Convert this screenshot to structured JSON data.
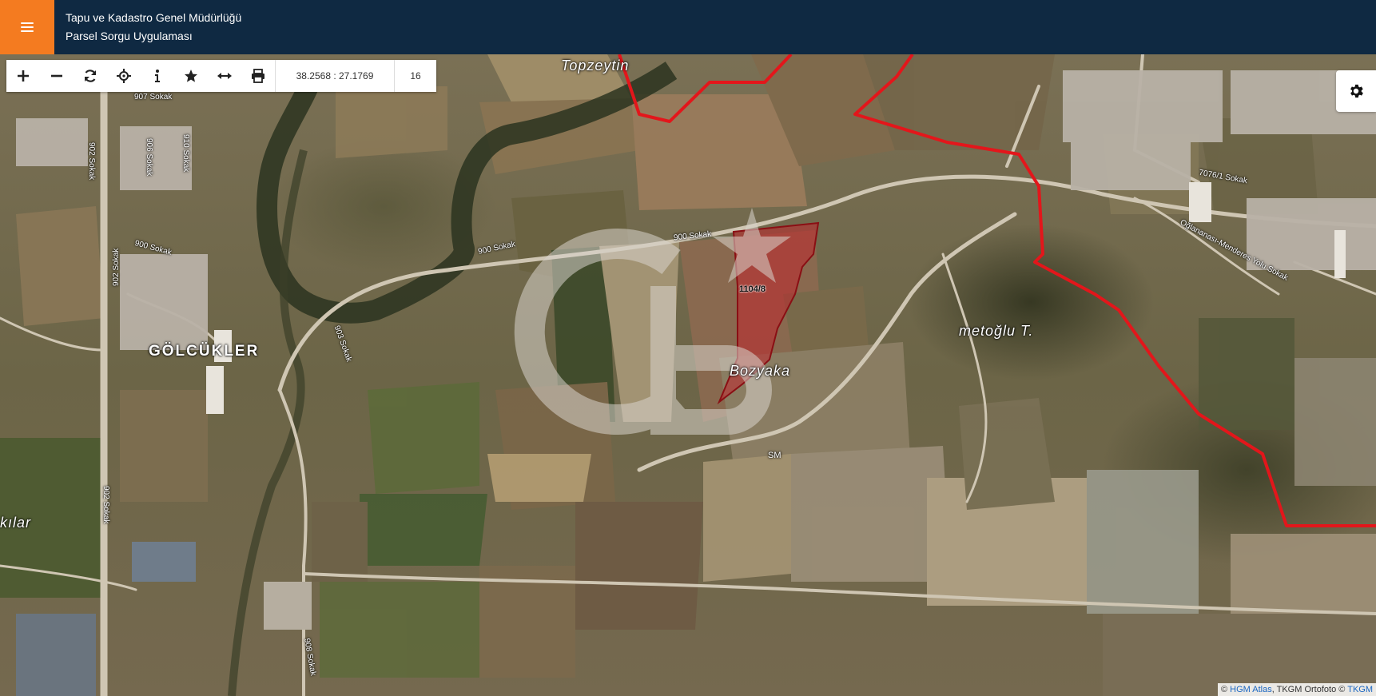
{
  "header": {
    "menu_icon": "hamburger-icon",
    "title_line1": "Tapu ve Kadastro Genel Müdürlüğü",
    "title_line2": "Parsel Sorgu Uygulaması",
    "bg_color": "#0f2942",
    "accent_color": "#f47b20"
  },
  "toolbar": {
    "buttons": [
      {
        "icon": "zoom-in-icon"
      },
      {
        "icon": "zoom-out-icon"
      },
      {
        "icon": "refresh-icon"
      },
      {
        "icon": "locate-icon"
      },
      {
        "icon": "info-icon"
      },
      {
        "icon": "star-icon"
      },
      {
        "icon": "measure-icon"
      },
      {
        "icon": "print-icon"
      }
    ],
    "coordinates": "38.2568 : 27.1769",
    "zoom_level": "16"
  },
  "settings": {
    "icon": "gear-icon"
  },
  "map": {
    "places": {
      "topzeytin": "Topzeytin",
      "golcukler": "GÖLCÜKLER",
      "bozyaka": "Bozyaka",
      "metoglu": "metoğlu T.",
      "kilar": "kılar",
      "sm": "SM"
    },
    "roads": {
      "r907": "907 Sokak",
      "r902a": "902 Sokak",
      "r906": "906 Sokak",
      "r910": "910 Sokak",
      "r900a": "900 Sokak",
      "r900b": "900 Sokak",
      "r900c": "900 Sokak",
      "r902b": "902 Sokak",
      "r903": "903 Sokak",
      "r902c": "902 Sokak",
      "r7076": "7076/1 Sokak",
      "oglananasi": "Oğlananası-Menderes Yolu Sokak",
      "r908": "908 Sokak"
    },
    "parcel_id": "1104/8",
    "parcel_color": "#c0272d",
    "boundary_color": "#e3161b"
  },
  "attribution": {
    "prefix": "©",
    "hgm": "HGM Atlas",
    "middle": ", TKGM Ortofoto ©",
    "tkgm": "TKGM"
  }
}
